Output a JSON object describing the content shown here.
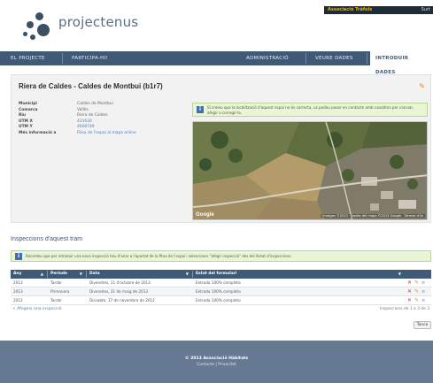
{
  "header": {
    "logo_text": "projectenus",
    "user_name": "Associació Tràfols",
    "logout_label": "Surt"
  },
  "nav": {
    "items": [
      "EL PROJECTE",
      "PARTICIPA-HI!",
      "ADMINISTRACIÓ",
      "VEURE DADES",
      "INTRODUIR DADES"
    ],
    "active": "INTRODUIR DADES"
  },
  "detail": {
    "title": "Riera de Caldes - Caldes de Montbui (b1r7)",
    "fields": [
      {
        "key": "Municipi",
        "value": "Caldes de Montbui"
      },
      {
        "key": "Comarca",
        "value": "Vallès"
      },
      {
        "key": "Riu",
        "value": "Riera de Caldes"
      },
      {
        "key": "UTM X",
        "value": "431630"
      },
      {
        "key": "UTM Y",
        "value": "4608749"
      },
      {
        "key": "Més informació a",
        "value": "Fitxa de l'espai al mapa online"
      }
    ],
    "note": "Si creieu que la localització d'aquest espai no és correcta, us podeu posar en contacte amb nosaltres per canviar, afegir o corregir-la.",
    "map_brand": "Google",
    "map_attrib": "Imatges ©2013 · Dades del mapa ©2013 Google · Termes d'ús"
  },
  "inspections": {
    "title": "Inspeccions d'aquest tram",
    "alert": "Recordeu que per introduir una nova inspecció heu d'anar a l'apartat de la fitxa de l'espai i seleccionar \"afegir inspecció\" des del llistat d'inspeccions.",
    "columns": [
      "Any",
      "Període",
      "Data",
      "Estat del formulari"
    ],
    "rows": [
      {
        "any": "2013",
        "periode": "Tardor",
        "data": "Divendres, 11 d'octubre de 2013",
        "estat": "Entrada 100% completa"
      },
      {
        "any": "2013",
        "periode": "Primavera",
        "data": "Divendres, 31 de maig de 2013",
        "estat": "Entrada 100% completa"
      },
      {
        "any": "2012",
        "periode": "Tardor",
        "data": "Dissabte, 17 de novembre de 2012",
        "estat": "Entrada 100% completa"
      }
    ],
    "add_link": "+ Afegeix una inspecció",
    "pager": "Inspeccions de 1 a 3 de 3",
    "close_label": "Tanca"
  },
  "footer": {
    "line1": "© 2013 Associació Hàbitats",
    "line2": "Contacte | Privacitat"
  },
  "colors": {
    "nav": "#3f5a77",
    "footer": "#667b93",
    "note_bg": "#eaf5d8",
    "link": "#4f7fb6"
  }
}
